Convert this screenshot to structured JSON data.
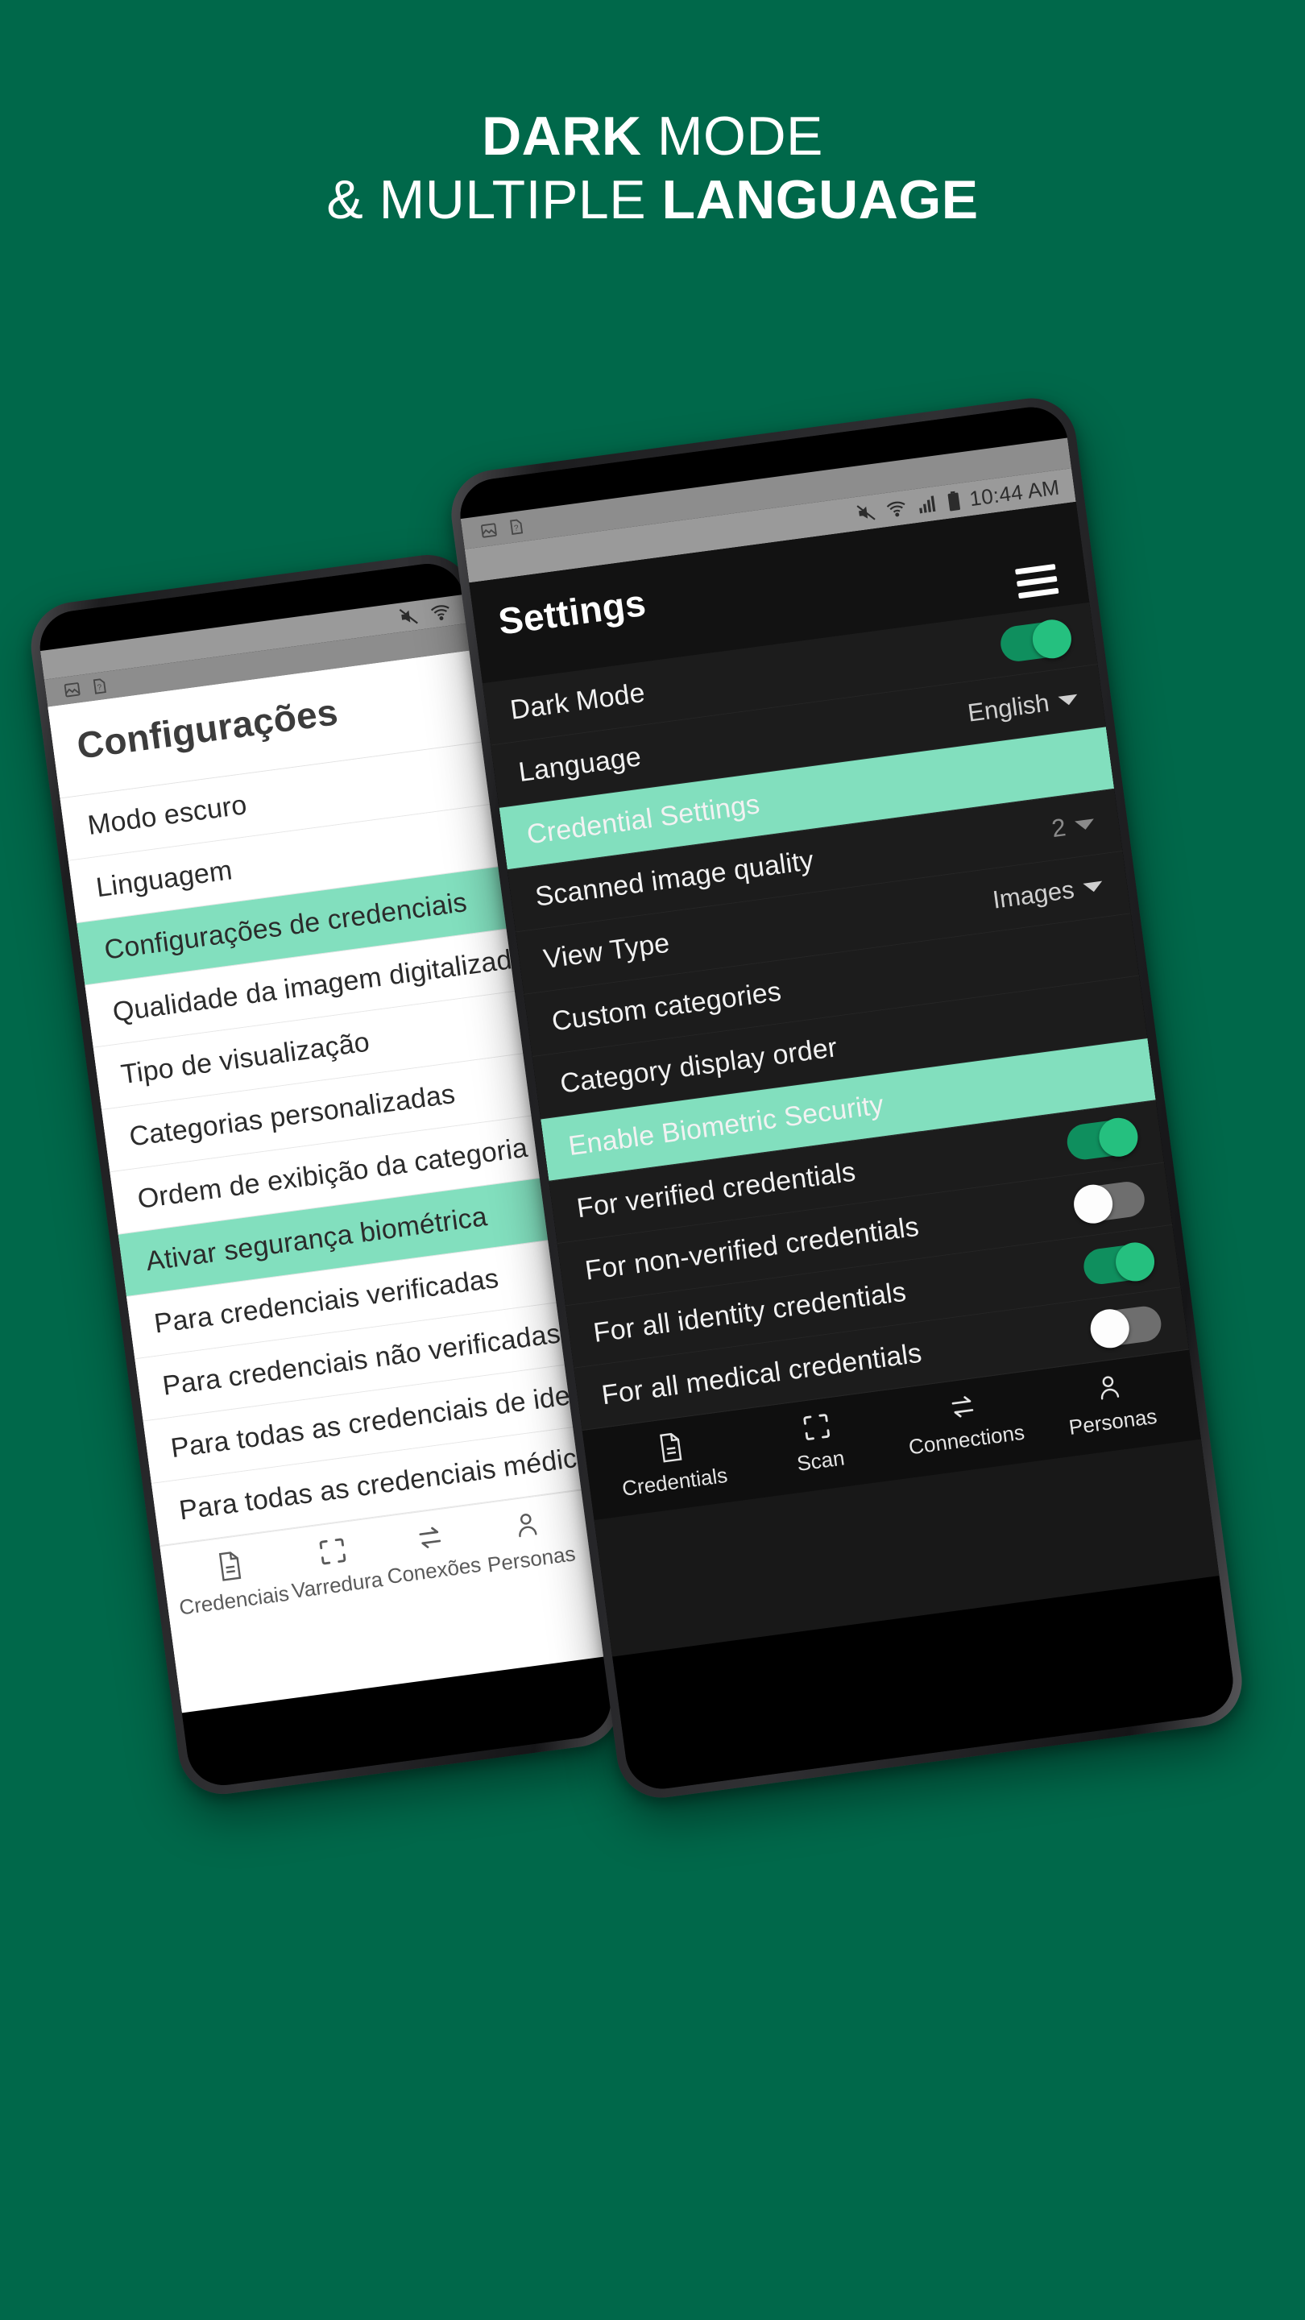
{
  "headline": {
    "line1_bold": "DARK",
    "line1_rest": " MODE",
    "line2_rest": "& MULTIPLE ",
    "line2_bold": "LANGUAGE"
  },
  "colors": {
    "background_green": "#00684a",
    "accent_mint": "#82dfbe",
    "toggle_on": "#25c07f",
    "toggle_off_track": "#6e6e6e",
    "dark_screen": "#1c1c1c",
    "light_screen": "#ffffff"
  },
  "dark_phone": {
    "status_bar": {
      "notification_icons": [
        "image-icon",
        "document-question-icon"
      ],
      "system_icons": [
        "mute-icon",
        "wifi-icon",
        "signal-icon",
        "battery-icon"
      ],
      "clock": "10:44 AM"
    },
    "appbar": {
      "title": "Settings",
      "menu_icon": "hamburger-icon"
    },
    "rows": [
      {
        "label": "Dark Mode",
        "type": "toggle",
        "state": "on"
      },
      {
        "label": "Language",
        "type": "value",
        "value": "English",
        "caret": true
      },
      {
        "label": "Credential Settings",
        "type": "section"
      },
      {
        "label": "Scanned image quality",
        "type": "value",
        "value": "2",
        "caret": true,
        "dim": true
      },
      {
        "label": "View Type",
        "type": "value",
        "value": "Images",
        "caret": true
      },
      {
        "label": "Custom categories",
        "type": "plain"
      },
      {
        "label": "Category display order",
        "type": "plain"
      },
      {
        "label": "Enable Biometric Security",
        "type": "section"
      },
      {
        "label": "For verified credentials",
        "type": "toggle",
        "state": "on"
      },
      {
        "label": "For non-verified credentials",
        "type": "toggle",
        "state": "off"
      },
      {
        "label": "For all identity credentials",
        "type": "toggle",
        "state": "on"
      },
      {
        "label": "For all medical credentials",
        "type": "toggle",
        "state": "off"
      }
    ],
    "bottom_nav": [
      {
        "label": "Credentials",
        "icon": "document-icon"
      },
      {
        "label": "Scan",
        "icon": "scan-frame-icon"
      },
      {
        "label": "Connections",
        "icon": "swap-arrows-icon"
      },
      {
        "label": "Personas",
        "icon": "person-icon"
      }
    ]
  },
  "light_phone": {
    "status_bar": {
      "notification_icons": [
        "image-icon",
        "document-question-icon"
      ],
      "system_icons": [
        "mute-icon",
        "wifi-icon"
      ]
    },
    "appbar": {
      "title": "Configurações"
    },
    "rows": [
      {
        "label": "Modo escuro",
        "type": "plain"
      },
      {
        "label": "Linguagem",
        "type": "plain"
      },
      {
        "label": "Configurações de credenciais",
        "type": "section"
      },
      {
        "label": "Qualidade da imagem digitalizada",
        "type": "plain"
      },
      {
        "label": "Tipo de visualização",
        "type": "plain"
      },
      {
        "label": "Categorias personalizadas",
        "type": "plain"
      },
      {
        "label": "Ordem de exibição da categoria",
        "type": "plain"
      },
      {
        "label": "Ativar segurança biométrica",
        "type": "section"
      },
      {
        "label": "Para credenciais verificadas",
        "type": "plain"
      },
      {
        "label": "Para credenciais não verificadas",
        "type": "plain"
      },
      {
        "label": "Para todas as credenciais de identidade",
        "type": "plain"
      },
      {
        "label": "Para todas as credenciais médicas",
        "type": "plain"
      }
    ],
    "bottom_nav": [
      {
        "label": "Credenciais",
        "icon": "document-icon"
      },
      {
        "label": "Varredura",
        "icon": "scan-frame-icon"
      },
      {
        "label": "Conexões",
        "icon": "swap-arrows-icon"
      },
      {
        "label": "Personas",
        "icon": "person-icon"
      }
    ]
  }
}
